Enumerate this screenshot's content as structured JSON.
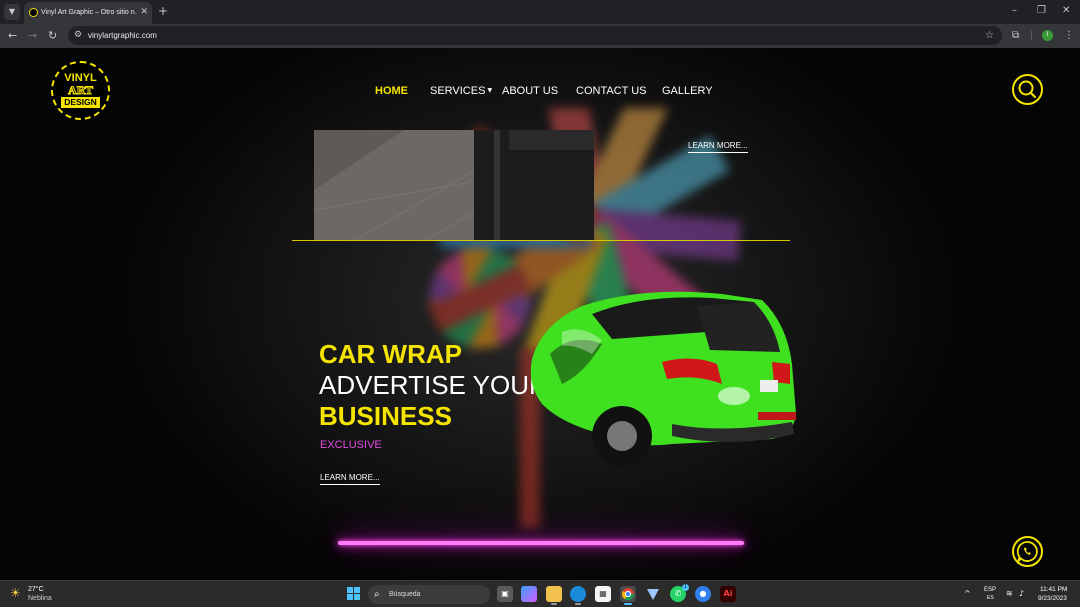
{
  "browser": {
    "tab_list_icon": "chevron-down-icon",
    "tab_title": "Vinyl Art Graphic – Otro sitio n…",
    "close_glyph": "✕",
    "new_tab_glyph": "+",
    "url": "vinylartgraphic.com",
    "profile_initial": "I",
    "window_controls": [
      "–",
      "❐",
      "✕"
    ]
  },
  "site": {
    "logo": {
      "line1": "VINYL",
      "line2": "ART",
      "line3": "DESIGN"
    },
    "nav": [
      {
        "label": "HOME",
        "active": true
      },
      {
        "label": "SERVICES",
        "has_dropdown": true
      },
      {
        "label": "ABOUT US"
      },
      {
        "label": "CONTACT US"
      },
      {
        "label": "GALLERY"
      }
    ],
    "slide1": {
      "learn_more": "LEARN MORE..."
    },
    "slide2": {
      "headline_1": "CAR WRAP",
      "headline_2": "ADVERTISE YOUR",
      "headline_3": "BUSINESS",
      "tag": "EXCLUSIVE",
      "learn_more": "LEARN MORE..."
    },
    "colors": {
      "accent": "#f5e400",
      "neon": "#e24be0",
      "car": "#3fe020"
    }
  },
  "taskbar": {
    "weather_temp": "27°C",
    "weather_condition": "Neblina",
    "search_placeholder": "Búsqueda",
    "whatsapp_badge": "1",
    "lang_top": "ESP",
    "lang_bottom": "ES",
    "time": "11:41 PM",
    "date": "9/23/2023"
  }
}
